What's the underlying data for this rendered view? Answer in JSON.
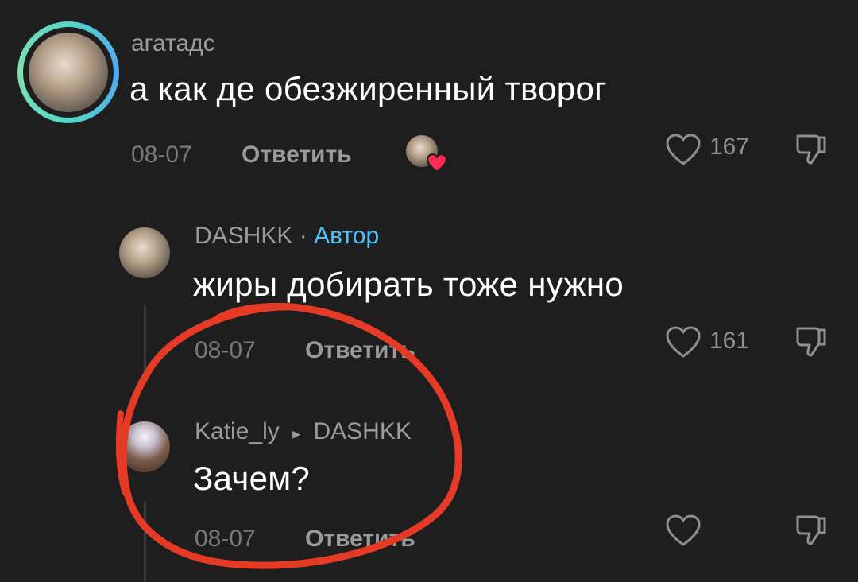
{
  "comments": [
    {
      "username": "агатадс",
      "text": "а как де обезжиренный творог",
      "date": "08-07",
      "reply_label": "Ответить",
      "likes": "167"
    },
    {
      "username": "DASHKK",
      "separator": "·",
      "author_badge": "Автор",
      "text": "жиры добирать тоже нужно",
      "date": "08-07",
      "reply_label": "Ответить",
      "likes": "161"
    },
    {
      "username": "Katie_ly",
      "reply_arrow": "▸",
      "reply_to": "DASHKK",
      "text": "Зачем?",
      "date": "08-07",
      "reply_label": "Ответить",
      "likes": ""
    }
  ],
  "icons": {
    "like": "heart-icon",
    "dislike": "thumbs-down-icon"
  },
  "colors": {
    "background": "#1e1e1e",
    "author_badge": "#4fc3f7",
    "annotation_circle": "#e53a26",
    "story_ring": "#56d6c8"
  }
}
